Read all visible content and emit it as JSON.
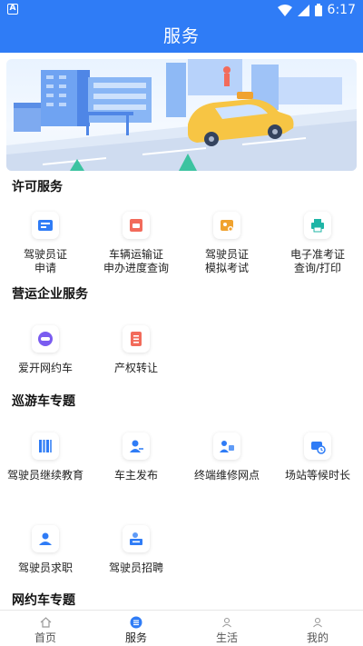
{
  "status_bar": {
    "left_icon": "A",
    "time": "6:17"
  },
  "header": {
    "title": "服务"
  },
  "sections": [
    {
      "title": "许可服务",
      "items": [
        {
          "lines": [
            "驾驶员证",
            "申请"
          ],
          "icon": "driver-license-icon"
        },
        {
          "lines": [
            "车辆运输证",
            "申办进度查询"
          ],
          "icon": "vehicle-certificate-icon"
        },
        {
          "lines": [
            "驾驶员证",
            "模拟考试"
          ],
          "icon": "mock-exam-icon"
        },
        {
          "lines": [
            "电子准考证",
            "查询/打印"
          ],
          "icon": "printer-icon"
        }
      ]
    },
    {
      "title": "营运企业服务",
      "items": [
        {
          "lines": [
            "爱开网约车"
          ],
          "icon": "ride-hailing-icon"
        },
        {
          "lines": [
            "产权转让"
          ],
          "icon": "property-transfer-icon"
        }
      ]
    },
    {
      "title": "巡游车专题",
      "items": [
        {
          "lines": [
            "驾驶员继续教育"
          ],
          "icon": "books-icon"
        },
        {
          "lines": [
            "车主发布"
          ],
          "icon": "owner-publish-icon"
        },
        {
          "lines": [
            "终端维修网点"
          ],
          "icon": "repair-icon"
        },
        {
          "lines": [
            "场站等候时长"
          ],
          "icon": "station-wait-icon"
        },
        {
          "lines": [
            "驾驶员求职"
          ],
          "icon": "job-seeker-icon"
        },
        {
          "lines": [
            "驾驶员招聘"
          ],
          "icon": "recruitment-icon"
        }
      ]
    },
    {
      "title": "网约车专题",
      "items": []
    }
  ],
  "bottom_nav": [
    {
      "label": "首页",
      "icon": "home-icon"
    },
    {
      "label": "服务",
      "icon": "service-icon",
      "active": true
    },
    {
      "label": "生活",
      "icon": "life-icon"
    },
    {
      "label": "我的",
      "icon": "profile-icon"
    }
  ],
  "colors": {
    "primary": "#2f7cf6",
    "accent_orange": "#f0a22e",
    "accent_red": "#f26b5b",
    "accent_purple": "#7a5cf0"
  }
}
